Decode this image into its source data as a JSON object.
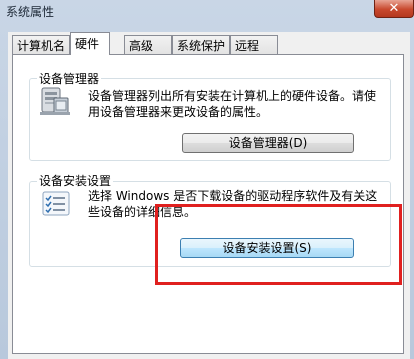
{
  "window": {
    "title": "系统属性",
    "close_glyph": "✕"
  },
  "tabs": [
    {
      "label": "计算机名",
      "active": false
    },
    {
      "label": "硬件",
      "active": true
    },
    {
      "label": "高级",
      "active": false
    },
    {
      "label": "系统保护",
      "active": false
    },
    {
      "label": "远程",
      "active": false
    }
  ],
  "device_manager": {
    "group_title": "设备管理器",
    "description_line1": "设备管理器列出所有安装在计算机上的硬件设备。请使",
    "description_line2": "用设备管理器来更改设备的属性。",
    "button_label": "设备管理器(D)",
    "icon": "device-manager-icon"
  },
  "device_install": {
    "group_title": "设备安装设置",
    "description_line1": "选择 Windows 是否下载设备的驱动程序软件及有关这",
    "description_line2": "些设备的详细信息。",
    "button_label": "设备安装设置(S)",
    "icon": "checklist-icon"
  },
  "colors": {
    "highlight_box": "#e0201f",
    "default_button_border": "#3c7fb1"
  }
}
